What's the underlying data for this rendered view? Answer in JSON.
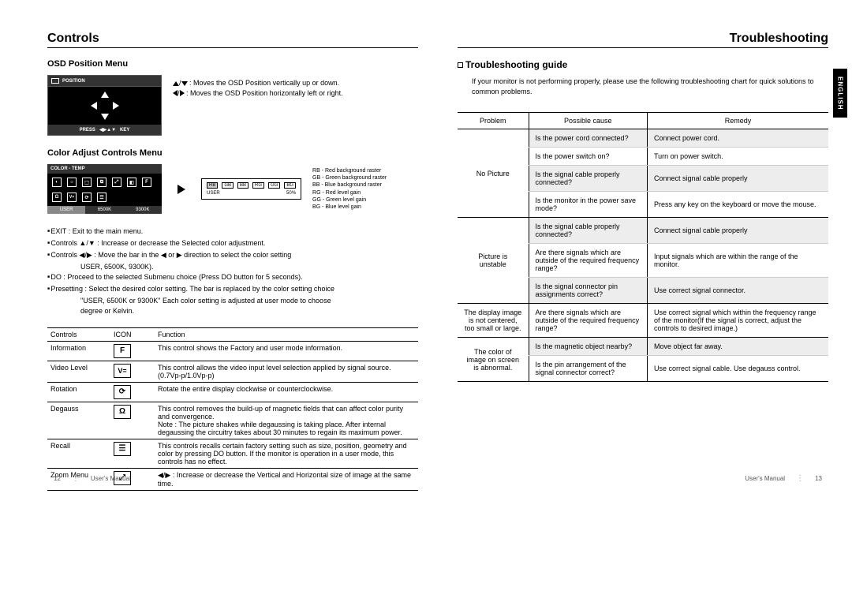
{
  "left": {
    "header": "Controls",
    "osd_title": "OSD Position Menu",
    "osd_box_title": "POSITION",
    "osd_box_footer_left": "PRESS",
    "osd_box_footer_right": "KEY",
    "osd_desc_v": ": Moves the OSD Position vertically up or down.",
    "osd_desc_h": ": Moves the OSD Position horizontally left or right.",
    "color_title": "Color Adjust Controls Menu",
    "osd2_title": "COLOR - TEMP",
    "osd2_tabs": {
      "user": "USER",
      "k65": "6500K",
      "k93": "9300K"
    },
    "panel_cells": [
      "RB",
      "GB",
      "BB",
      "RG",
      "GG",
      "BG"
    ],
    "panel_user": "USER",
    "panel_pct": "50%",
    "legend": {
      "rb": "RB - Red background raster",
      "gb": "GB - Green background raster",
      "bb": "BB - Blue background raster",
      "rg": "RG - Red level gain",
      "gg": "GG - Green level gain",
      "bg": "BG - Blue level gain"
    },
    "notes": {
      "n1": "EXIT : Exit to the main menu.",
      "n2": "Controls ▲/▼ : Increase or decrease the Selected color adjustment.",
      "n3": "Controls ◀/▶ : Move the bar in the ◀ or ▶ direction to select the color setting",
      "n3b": "USER, 6500K, 9300K).",
      "n4": "DO : Proceed to the selected Submenu choice (Press DO button for 5 seconds).",
      "n5": "Presetting : Select the desired color setting. The bar is replaced by the color setting choice",
      "n5b": "\"USER, 6500K or 9300K\" Each color setting is adjusted at user mode to choose",
      "n5c": "degree or Kelvin."
    },
    "table_head": {
      "c": "Controls",
      "i": "ICON",
      "f": "Function"
    },
    "rows": {
      "info": {
        "c": "Information",
        "f": "This control shows the Factory and user mode information."
      },
      "vid": {
        "c": "Video Level",
        "f": "This control allows the video input level selection applied by signal source. (0.7Vp-p/1.0Vp-p)"
      },
      "rot": {
        "c": "Rotation",
        "f": "Rotate the entire display clockwise or counterclockwise."
      },
      "deg": {
        "c": "Degauss",
        "f": "This control removes the build-up of magnetic fields that can affect color purity and convergence.",
        "f2": "Note : The picture shakes while degaussing is taking place. After internal degaussing the circuitry takes about 30 minutes to regain its maximum power."
      },
      "rec": {
        "c": "Recall",
        "f": "This controls recalls certain factory setting such as size, position, geometry and color by pressing DO button. If the monitor is operation in a user mode, this controls has no effect."
      },
      "zoom": {
        "c": "Zoom Menu",
        "f": "◀/▶ : Increase or decrease the Vertical and Horizontal size of image at the same time."
      }
    },
    "pgnum": "12",
    "pgtxt": "User's Manual"
  },
  "right": {
    "header": "Troubleshooting",
    "eng": "ENGLISH",
    "title": "Troubleshooting guide",
    "intro": "If your monitor is not performing properly, please use the following troubleshooting chart for quick solutions to common problems.",
    "th": {
      "p": "Problem",
      "c": "Possible cause",
      "r": "Remedy"
    },
    "g1_label": "No Picture",
    "g1": [
      {
        "c": "Is the power cord connected?",
        "r": "Connect power cord.",
        "s": true
      },
      {
        "c": "Is the power switch on?",
        "r": "Turn on power switch.",
        "s": false
      },
      {
        "c": "Is the signal cable properly connected?",
        "r": "Connect signal cable properly",
        "s": true
      },
      {
        "c": "Is the monitor in the power save mode?",
        "r": "Press any key on the keyboard or move the mouse.",
        "s": false
      }
    ],
    "g2_label": "Picture is unstable",
    "g2": [
      {
        "c": "Is the signal cable properly connected?",
        "r": "Connect signal cable properly",
        "s": true
      },
      {
        "c": "Are there signals which are outside of the required frequency range?",
        "r": "Input signals which are within the range of the monitor.",
        "s": false
      },
      {
        "c": "Is the signal connector pin assignments correct?",
        "r": "Use correct signal connector.",
        "s": true
      }
    ],
    "g3_label": "The display image is not centered, too small or large.",
    "g3": [
      {
        "c": "Are there signals which are outside of the required frequency range?",
        "r": "Use correct signal which within the frequency range of the monitor(If the signal is correct, adjust the controls to desired image.)",
        "s": false
      }
    ],
    "g4_label": "The color of image on screen is abnormal.",
    "g4": [
      {
        "c": "Is the magnetic object nearby?",
        "r": "Move object far away.",
        "s": true
      },
      {
        "c": "Is the pin arrangement of the signal connector correct?",
        "r": "Use correct signal cable. Use degauss control.",
        "s": false
      }
    ],
    "pgtxt": "User's Manual",
    "pgnum": "13"
  }
}
